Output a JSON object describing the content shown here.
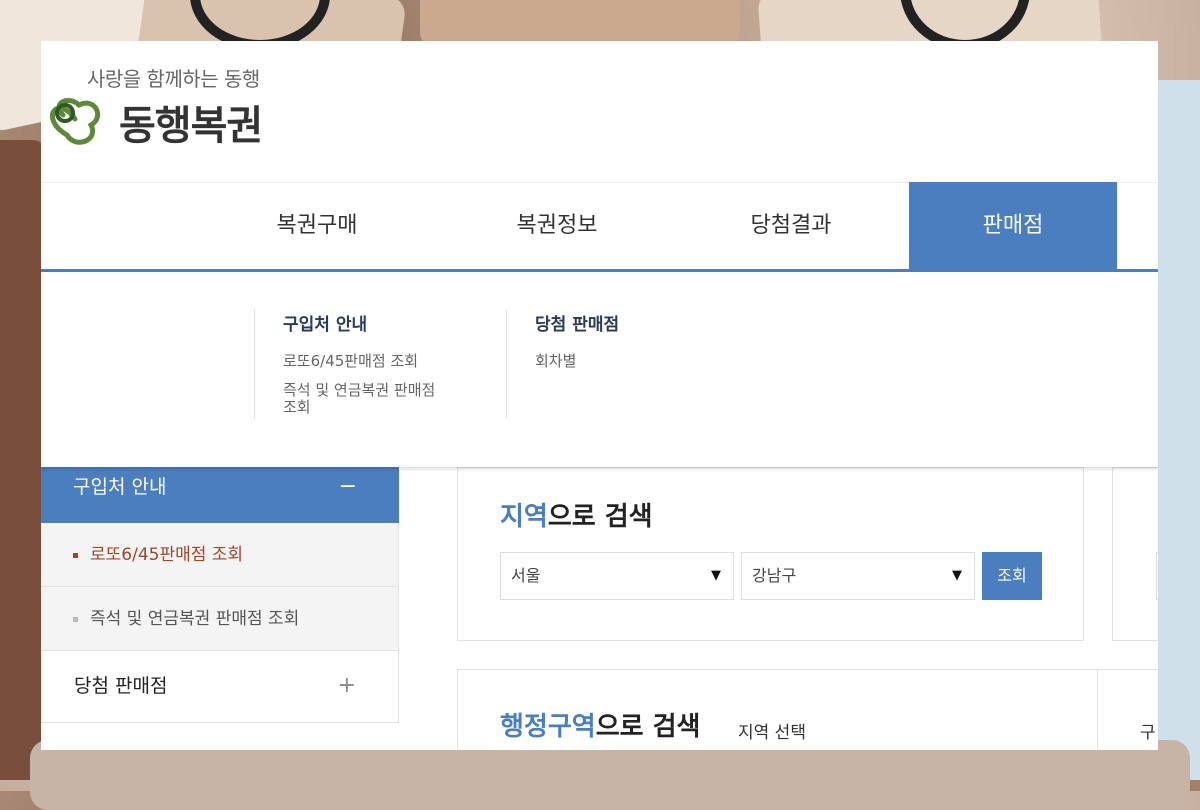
{
  "header": {
    "slogan": "사랑을 함께하는 동행",
    "brand": "동행복권"
  },
  "gnb": {
    "items": [
      {
        "label": "복권구매"
      },
      {
        "label": "복권정보"
      },
      {
        "label": "당첨결과"
      },
      {
        "label": "판매점",
        "active": true
      }
    ]
  },
  "dropdown": {
    "col1": {
      "title": "구입처 안내",
      "links": [
        "로또6/45판매점 조회",
        "즉석 및 연금복권 판매점",
        "조회"
      ]
    },
    "col2": {
      "title": "당첨 판매점",
      "links": [
        "회차별"
      ]
    }
  },
  "side": {
    "head": "구입처 안내",
    "head_icon": "−",
    "subs": [
      "로또6/45판매점 조회",
      "즉석 및 연금복권 판매점 조회"
    ],
    "item2": "당첨 판매점",
    "item2_icon": "+"
  },
  "region_search": {
    "title_hl": "지역",
    "title_rest": "으로 검색",
    "select1": "서울",
    "select2": "강남구",
    "button": "조회",
    "arrow": "▼"
  },
  "admin_search": {
    "title_hl": "행정구역",
    "title_rest": "으로 검색",
    "sub": "지역 선택",
    "edge_char": "구"
  },
  "colors": {
    "accent": "#4a7ebf",
    "active_sub": "#a0462a"
  }
}
